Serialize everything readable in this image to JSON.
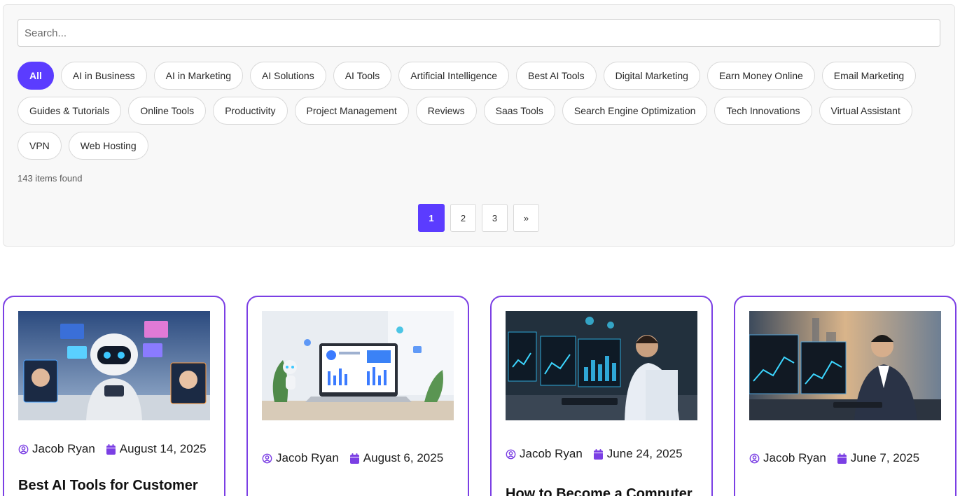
{
  "search": {
    "placeholder": "Search..."
  },
  "filters": {
    "categories": [
      {
        "label": "All",
        "active": true
      },
      {
        "label": "AI in Business"
      },
      {
        "label": "AI in Marketing"
      },
      {
        "label": "AI Solutions"
      },
      {
        "label": "AI Tools"
      },
      {
        "label": "Artificial Intelligence"
      },
      {
        "label": "Best AI Tools"
      },
      {
        "label": "Digital Marketing"
      },
      {
        "label": "Earn Money Online"
      },
      {
        "label": "Email Marketing"
      },
      {
        "label": "Guides & Tutorials"
      },
      {
        "label": "Online Tools"
      },
      {
        "label": "Productivity"
      },
      {
        "label": "Project Management"
      },
      {
        "label": "Reviews"
      },
      {
        "label": "Saas Tools"
      },
      {
        "label": "Search Engine Optimization"
      },
      {
        "label": "Tech Innovations"
      },
      {
        "label": "Virtual Assistant"
      },
      {
        "label": "VPN"
      },
      {
        "label": "Web Hosting"
      }
    ]
  },
  "results": {
    "count_text": "143 items found"
  },
  "pagination": {
    "pages": [
      "1",
      "2",
      "3"
    ],
    "current": "1",
    "next_label": "»"
  },
  "colors": {
    "accent": "#5b3cff",
    "card_border": "#7b3fe4"
  },
  "posts": [
    {
      "author": "Jacob Ryan",
      "date": "August 14, 2025",
      "title": "Best AI Tools for Customer",
      "image_icon": "ai-robot-image"
    },
    {
      "author": "Jacob Ryan",
      "date": "August 6, 2025",
      "title": "",
      "image_icon": "laptop-dashboard-image"
    },
    {
      "author": "Jacob Ryan",
      "date": "June 24, 2025",
      "title": "How to Become a Computer",
      "image_icon": "computer-operator-image"
    },
    {
      "author": "Jacob Ryan",
      "date": "June 7, 2025",
      "title": "",
      "image_icon": "businessman-computer-image"
    }
  ]
}
